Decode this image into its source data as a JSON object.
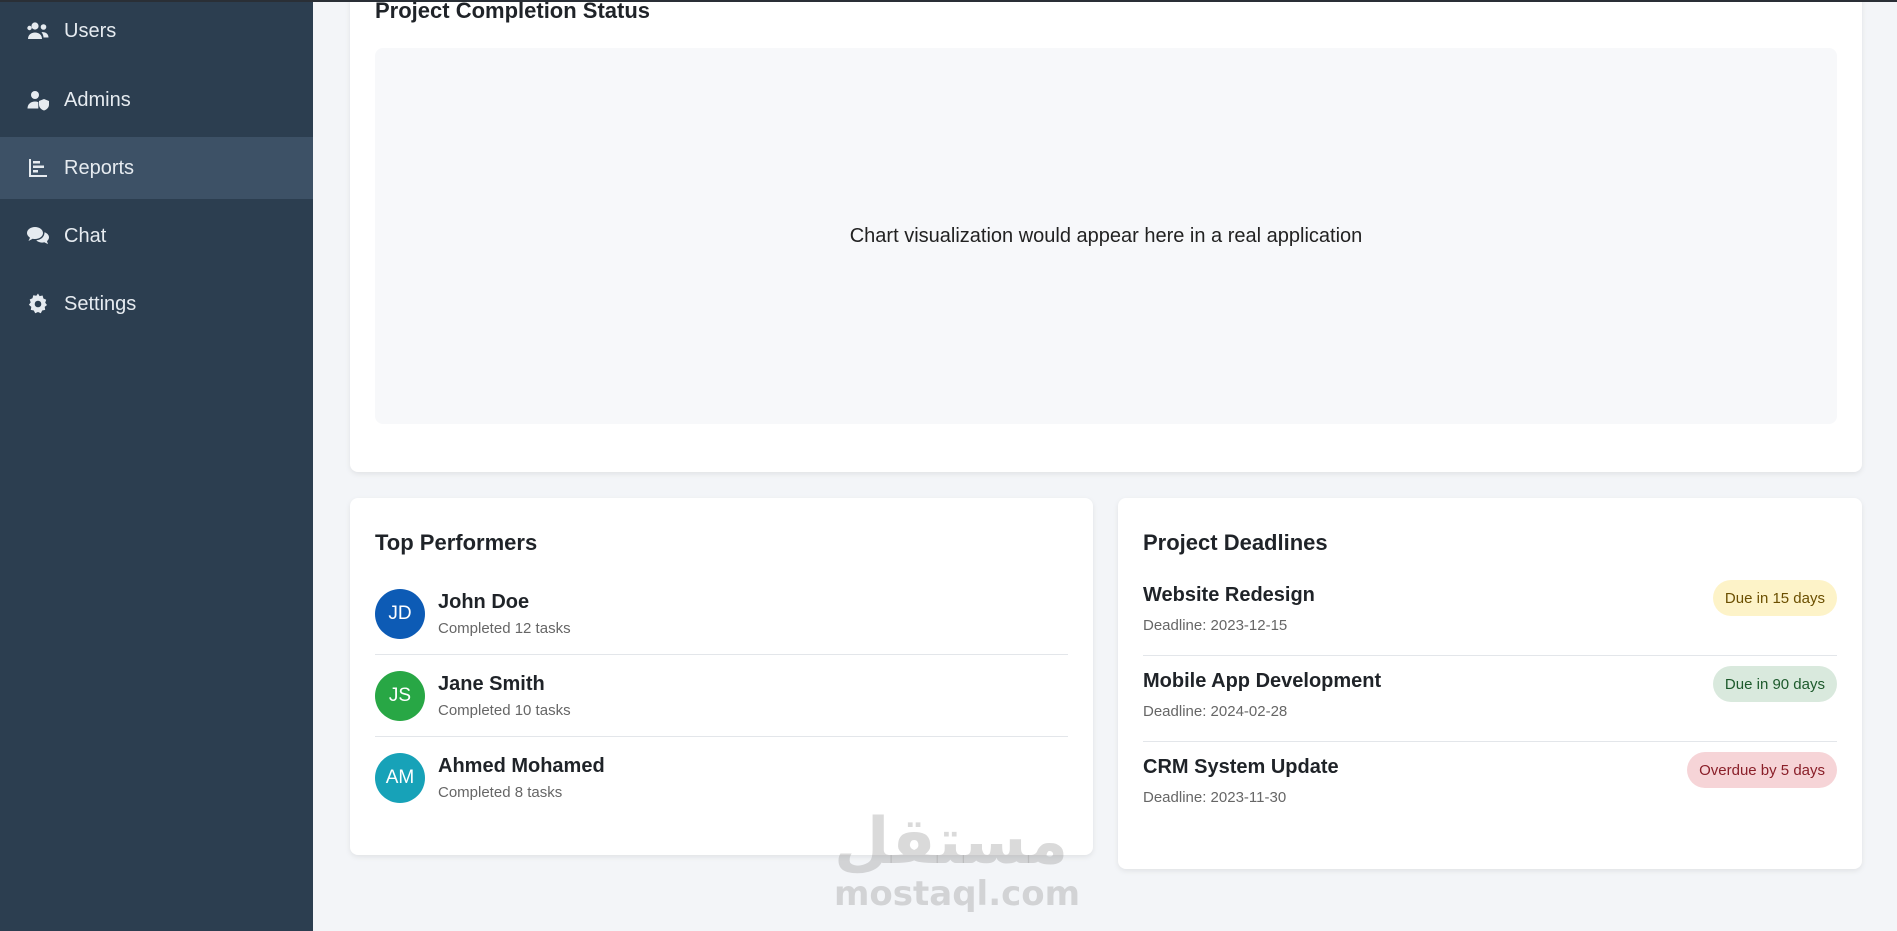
{
  "sidebar": {
    "items": [
      {
        "label": "Users",
        "icon": "users-icon",
        "active": false
      },
      {
        "label": "Admins",
        "icon": "user-shield-icon",
        "active": false
      },
      {
        "label": "Reports",
        "icon": "bar-chart-icon",
        "active": true
      },
      {
        "label": "Chat",
        "icon": "comments-icon",
        "active": false
      },
      {
        "label": "Settings",
        "icon": "gear-icon",
        "active": false
      }
    ]
  },
  "completion": {
    "title": "Project Completion Status",
    "placeholder": "Chart visualization would appear here in a real application"
  },
  "performers": {
    "title": "Top Performers",
    "items": [
      {
        "initials": "JD",
        "name": "John Doe",
        "subtitle": "Completed 12 tasks",
        "color": "#0d5bb5"
      },
      {
        "initials": "JS",
        "name": "Jane Smith",
        "subtitle": "Completed 10 tasks",
        "color": "#28a745"
      },
      {
        "initials": "AM",
        "name": "Ahmed Mohamed",
        "subtitle": "Completed 8 tasks",
        "color": "#17a2b8"
      }
    ]
  },
  "deadlines": {
    "title": "Project Deadlines",
    "items": [
      {
        "name": "Website Redesign",
        "deadline": "Deadline: 2023-12-15",
        "badge": "Due in 15 days",
        "status": "warning"
      },
      {
        "name": "Mobile App Development",
        "deadline": "Deadline: 2024-02-28",
        "badge": "Due in 90 days",
        "status": "success"
      },
      {
        "name": "CRM System Update",
        "deadline": "Deadline: 2023-11-30",
        "badge": "Overdue by 5 days",
        "status": "danger"
      }
    ]
  },
  "watermark": {
    "arabic": "مستقل",
    "latin": "mostaql.com"
  }
}
